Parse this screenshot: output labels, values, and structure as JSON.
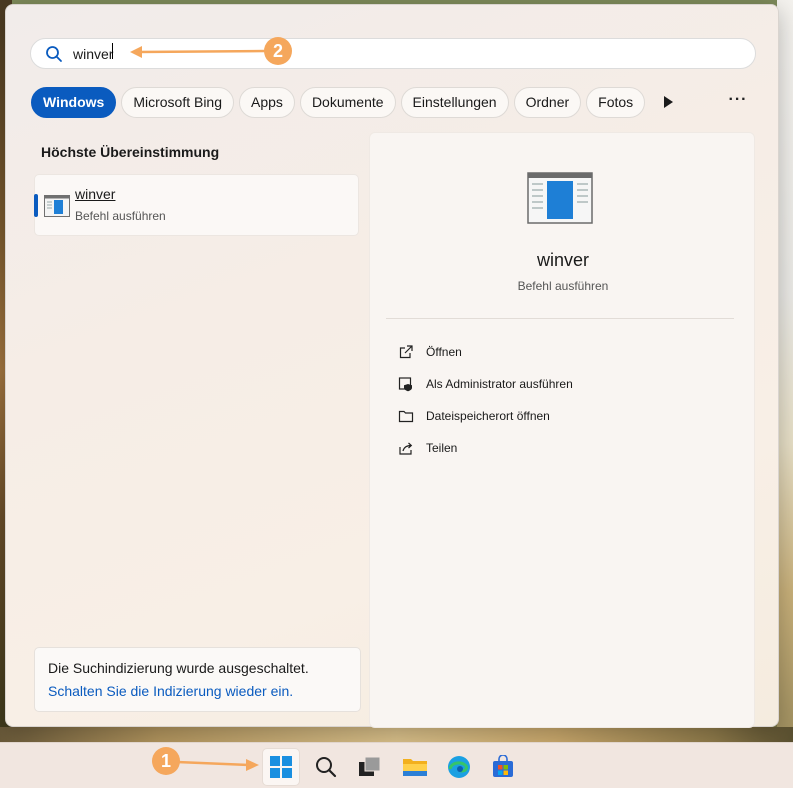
{
  "search": {
    "query": "winver",
    "placeholder": ""
  },
  "filters": {
    "chips": [
      "Windows",
      "Microsoft Bing",
      "Apps",
      "Dokumente",
      "Einstellungen",
      "Ordner",
      "Fotos"
    ],
    "active": "Windows",
    "more_icon": "play-icon",
    "overflow_icon": "ellipsis-icon"
  },
  "best_match": {
    "heading": "Höchste Übereinstimmung",
    "title": "winver",
    "subtitle": "Befehl ausführen",
    "icon": "window-app-icon"
  },
  "indexing_notice": {
    "text": "Die Suchindizierung wurde ausgeschaltet.",
    "link": "Schalten Sie die Indizierung wieder ein."
  },
  "detail": {
    "title": "winver",
    "subtitle": "Befehl ausführen",
    "actions": [
      {
        "label": "Öffnen",
        "icon": "open-external-icon"
      },
      {
        "label": "Als Administrator ausführen",
        "icon": "admin-shield-icon"
      },
      {
        "label": "Dateispeicherort öffnen",
        "icon": "folder-icon"
      },
      {
        "label": "Teilen",
        "icon": "share-icon"
      }
    ]
  },
  "taskbar": {
    "items": [
      "start-icon",
      "search-icon",
      "task-view-icon",
      "file-explorer-icon",
      "edge-icon",
      "store-icon"
    ]
  },
  "annotations": {
    "badge_1": "1",
    "badge_2": "2",
    "color": "#f5a75c"
  },
  "colors": {
    "accent": "#0a5bbf",
    "annotation": "#f5a75c"
  }
}
